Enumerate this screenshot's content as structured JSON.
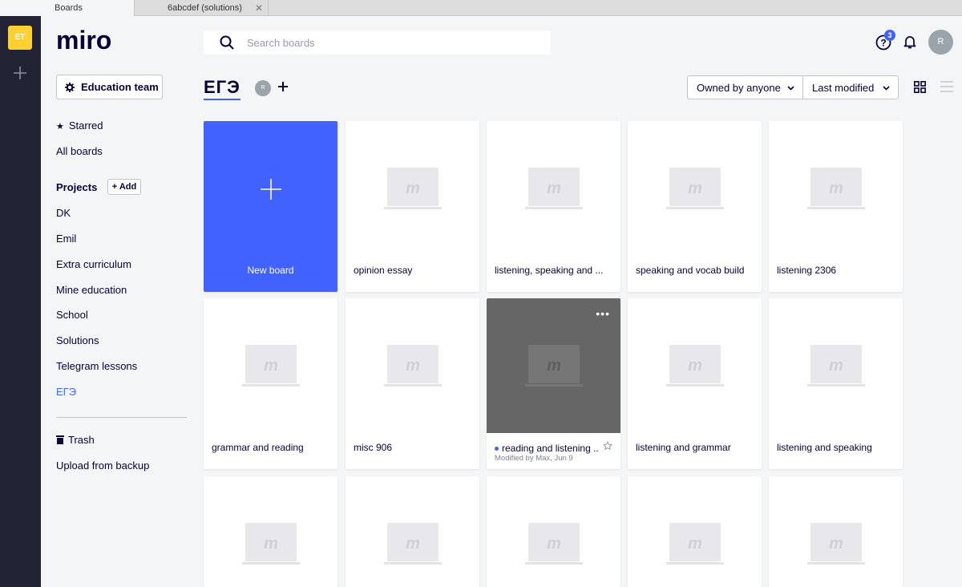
{
  "browser": {
    "tabs": [
      {
        "label": "Boards",
        "active": true
      },
      {
        "label": "6abcdef (solutions)",
        "active": false
      }
    ]
  },
  "rail": {
    "team_initials": "ET"
  },
  "brand": {
    "logo_text": "miro"
  },
  "sidebar": {
    "team_label": "Education team",
    "starred": "Starred",
    "all_boards": "All boards",
    "projects_label": "Projects",
    "add_label": "+ Add",
    "projects": [
      "DK",
      "Emil",
      "Extra curriculum",
      "Mine education",
      "School",
      "Solutions",
      "Telegram lessons",
      "ЕГЭ"
    ],
    "active_project": "ЕГЭ",
    "trash": "Trash",
    "upload": "Upload from backup"
  },
  "topbar": {
    "search_placeholder": "Search boards",
    "help_badge": "3",
    "avatar_initial": "R"
  },
  "header": {
    "title": "ЕГЭ",
    "member_initial": "R",
    "owner_filter": "Owned by anyone",
    "sort": "Last modified"
  },
  "boards": {
    "new_board": "New board",
    "row1": [
      "opinion essay",
      "listening, speaking and ...",
      "speaking and vocab build",
      "listening 2306"
    ],
    "row2": [
      "grammar and reading",
      "misc 906",
      "reading and listening ...",
      "listening and grammar",
      "listening and speaking"
    ],
    "hover_meta": "Modified by Max, Jun 9"
  },
  "colors": {
    "accent": "#4262ff",
    "rail": "#232336",
    "team_badge": "#ffd02f",
    "text": "#050038",
    "background": "#f4f5f7"
  },
  "icons": [
    "search-icon",
    "help-icon",
    "bell-icon",
    "gear-icon",
    "star-icon",
    "trash-icon",
    "plus-icon",
    "chevron-down-icon",
    "grid-view-icon",
    "list-view-icon",
    "more-icon",
    "board-thumbnail-icon"
  ]
}
